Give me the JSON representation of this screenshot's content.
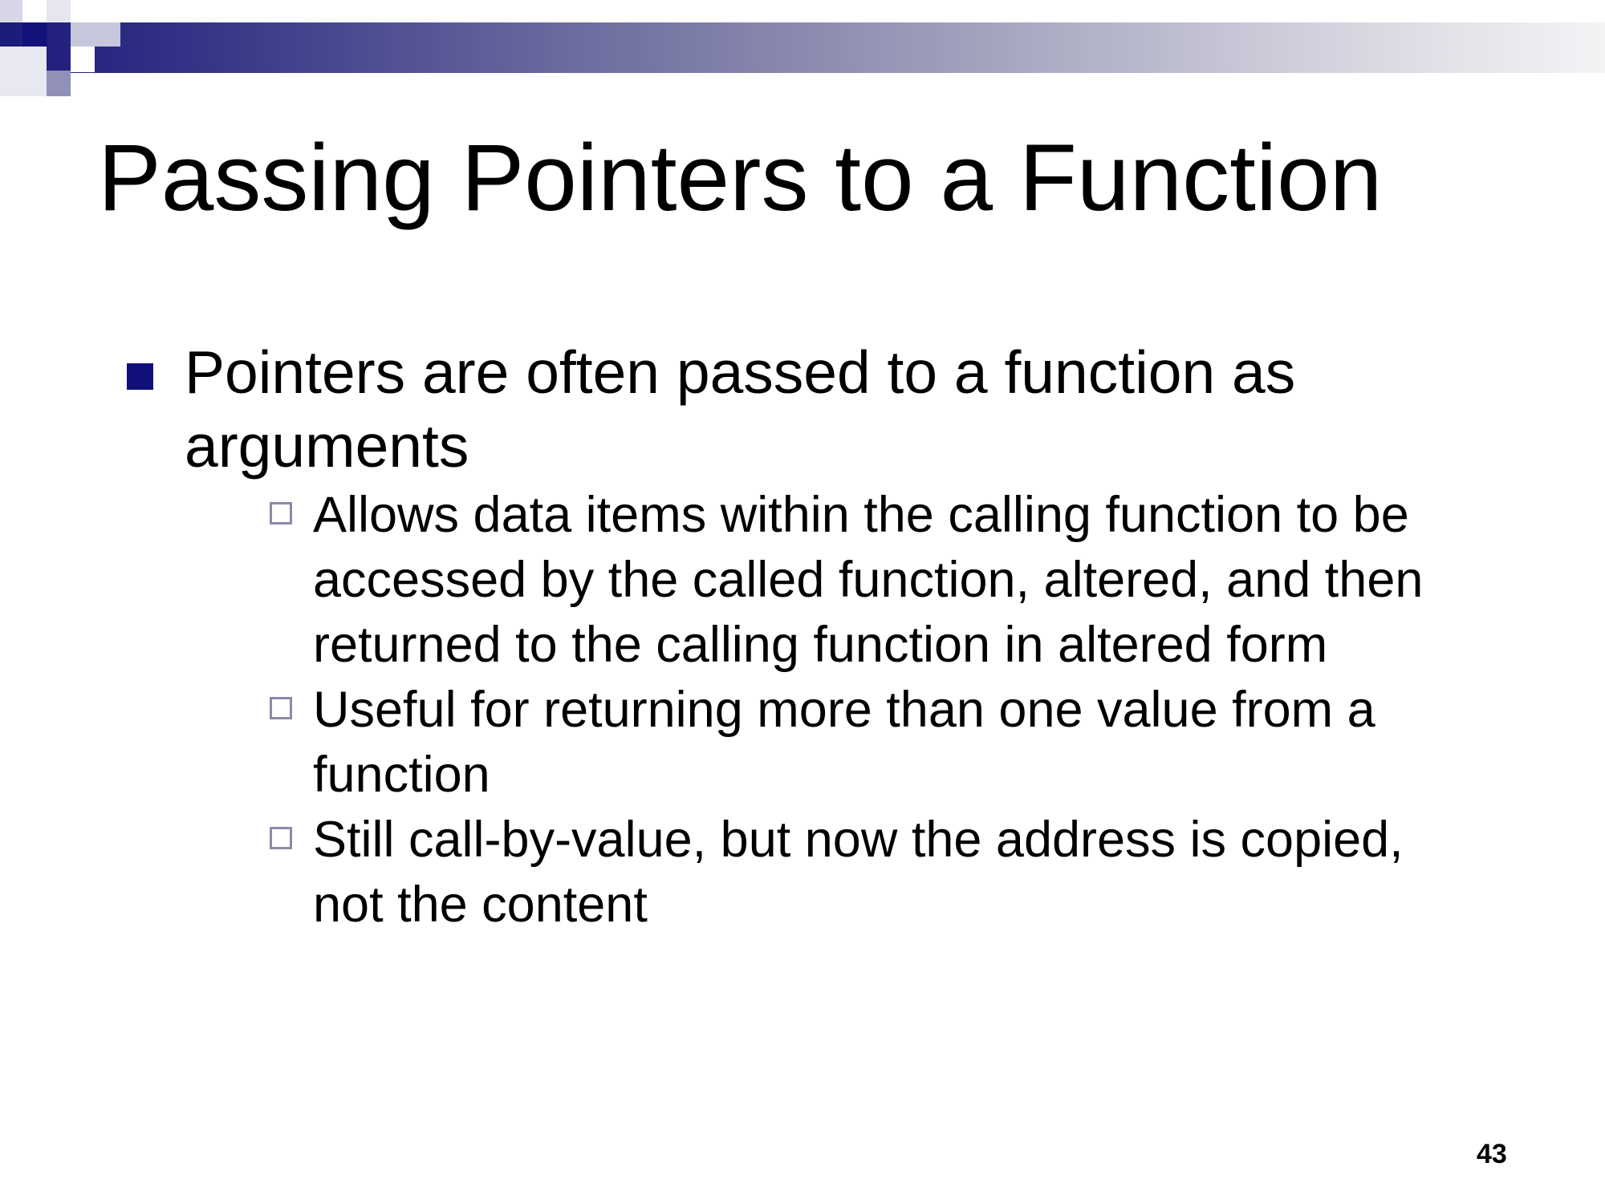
{
  "header": {
    "decor": "gradient-bar-with-squares",
    "accent_colors": [
      "#12127a",
      "#9090b8",
      "#c6c6dc",
      "#e8e8f0"
    ]
  },
  "slide": {
    "title": "Passing Pointers to a Function",
    "bullets": [
      {
        "text": "Pointers are often passed to a function as arguments",
        "marker_color": "#10107a",
        "sub_items": [
          "Allows data items within the calling function to be accessed by the called function, altered, and then returned to the calling function in altered form",
          "Useful for returning more than one value from a function",
          "Still call-by-value, but now the address is copied, not the content"
        ]
      }
    ],
    "page_number": "43"
  }
}
